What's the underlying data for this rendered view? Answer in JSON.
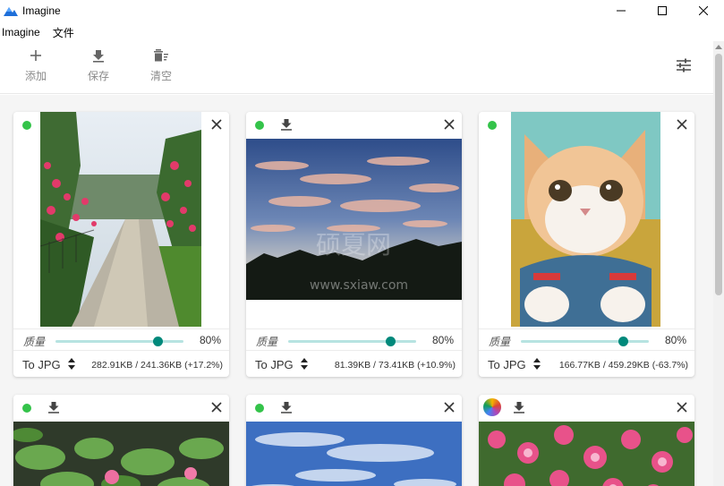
{
  "window": {
    "title": "Imagine"
  },
  "menu": {
    "items": [
      "Imagine",
      "文件"
    ]
  },
  "toolbar": {
    "add_label": "添加",
    "save_label": "保存",
    "clear_label": "清空"
  },
  "cards": [
    {
      "status": "done",
      "quality_label": "质量",
      "quality": 0.8,
      "quality_text": "80%",
      "format": "To JPG",
      "size_info": "282.91KB / 241.36KB (+17.2%)"
    },
    {
      "status": "done",
      "quality_label": "质量",
      "quality": 0.8,
      "quality_text": "80%",
      "format": "To JPG",
      "size_info": "81.39KB / 73.41KB (+10.9%)"
    },
    {
      "status": "done",
      "quality_label": "质量",
      "quality": 0.8,
      "quality_text": "80%",
      "format": "To JPG",
      "size_info": "166.77KB / 459.29KB (-63.7%)"
    },
    {
      "status": "done"
    },
    {
      "status": "done"
    },
    {
      "status": "processing"
    }
  ],
  "watermark": {
    "main": "硕夏网",
    "url": "www.sxiaw.com"
  },
  "colors": {
    "accent": "#00897b",
    "status_done": "#34c34a",
    "slider_track": "#b7e3e1"
  }
}
